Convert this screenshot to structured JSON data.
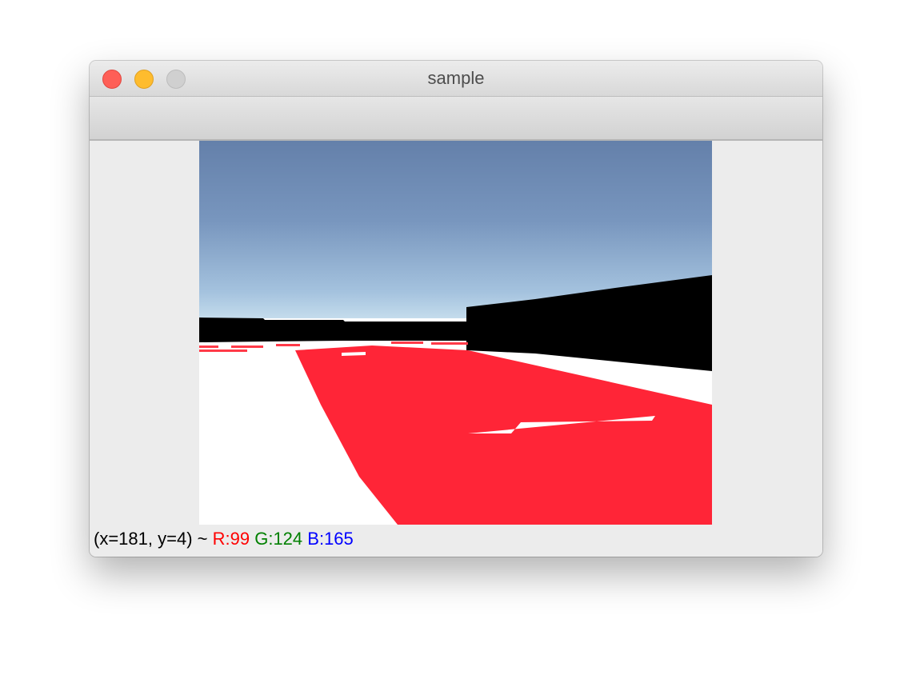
{
  "window": {
    "title": "sample"
  },
  "status": {
    "coords": "(x=181, y=4) ~",
    "r": "R:99",
    "g": "G:124",
    "b": "B:165",
    "r_color": "#ff0000",
    "g_color": "#008000",
    "b_color": "#0000ff"
  },
  "icons": {
    "close": "close-icon",
    "minimize": "minimize-icon",
    "zoom": "zoom-icon"
  },
  "colors": {
    "sky_top": "#6480aa",
    "sky_bottom": "#a8c8e0",
    "track_red": "#ff2537",
    "wall": "#000000",
    "ground": "#ffffff"
  }
}
